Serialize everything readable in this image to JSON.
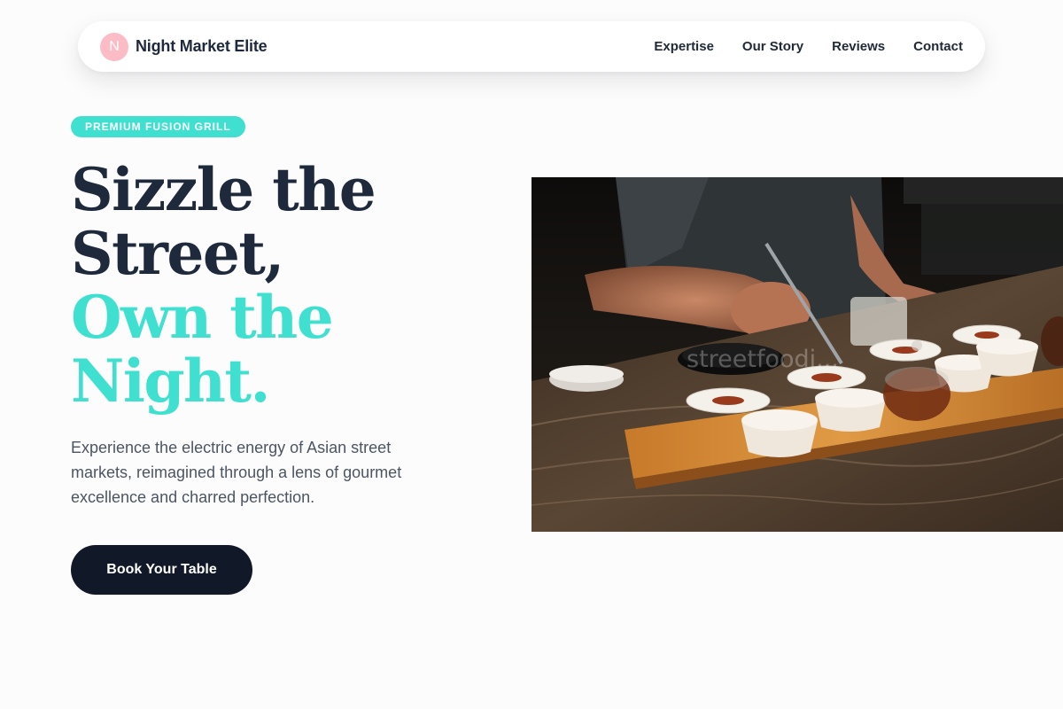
{
  "brand": {
    "initial": "N",
    "name": "Night Market Elite"
  },
  "nav": {
    "links": [
      "Expertise",
      "Our Story",
      "Reviews",
      "Contact"
    ]
  },
  "hero": {
    "badge": "PREMIUM FUSION GRILL",
    "headline_line1": "Sizzle the",
    "headline_line2": "Street,",
    "headline_line3": "Own the",
    "headline_line4": "Night.",
    "subtext": "Experience the electric energy of Asian street markets, reimagined through a lens of gourmet excellence and charred perfection.",
    "cta_label": "Book Your Table",
    "image_watermark": "streetfoodi..."
  },
  "colors": {
    "accent": "#40e0d0",
    "dark": "#1e293b",
    "cta_bg": "#111827",
    "logo_bg": "#fbbcc6"
  }
}
